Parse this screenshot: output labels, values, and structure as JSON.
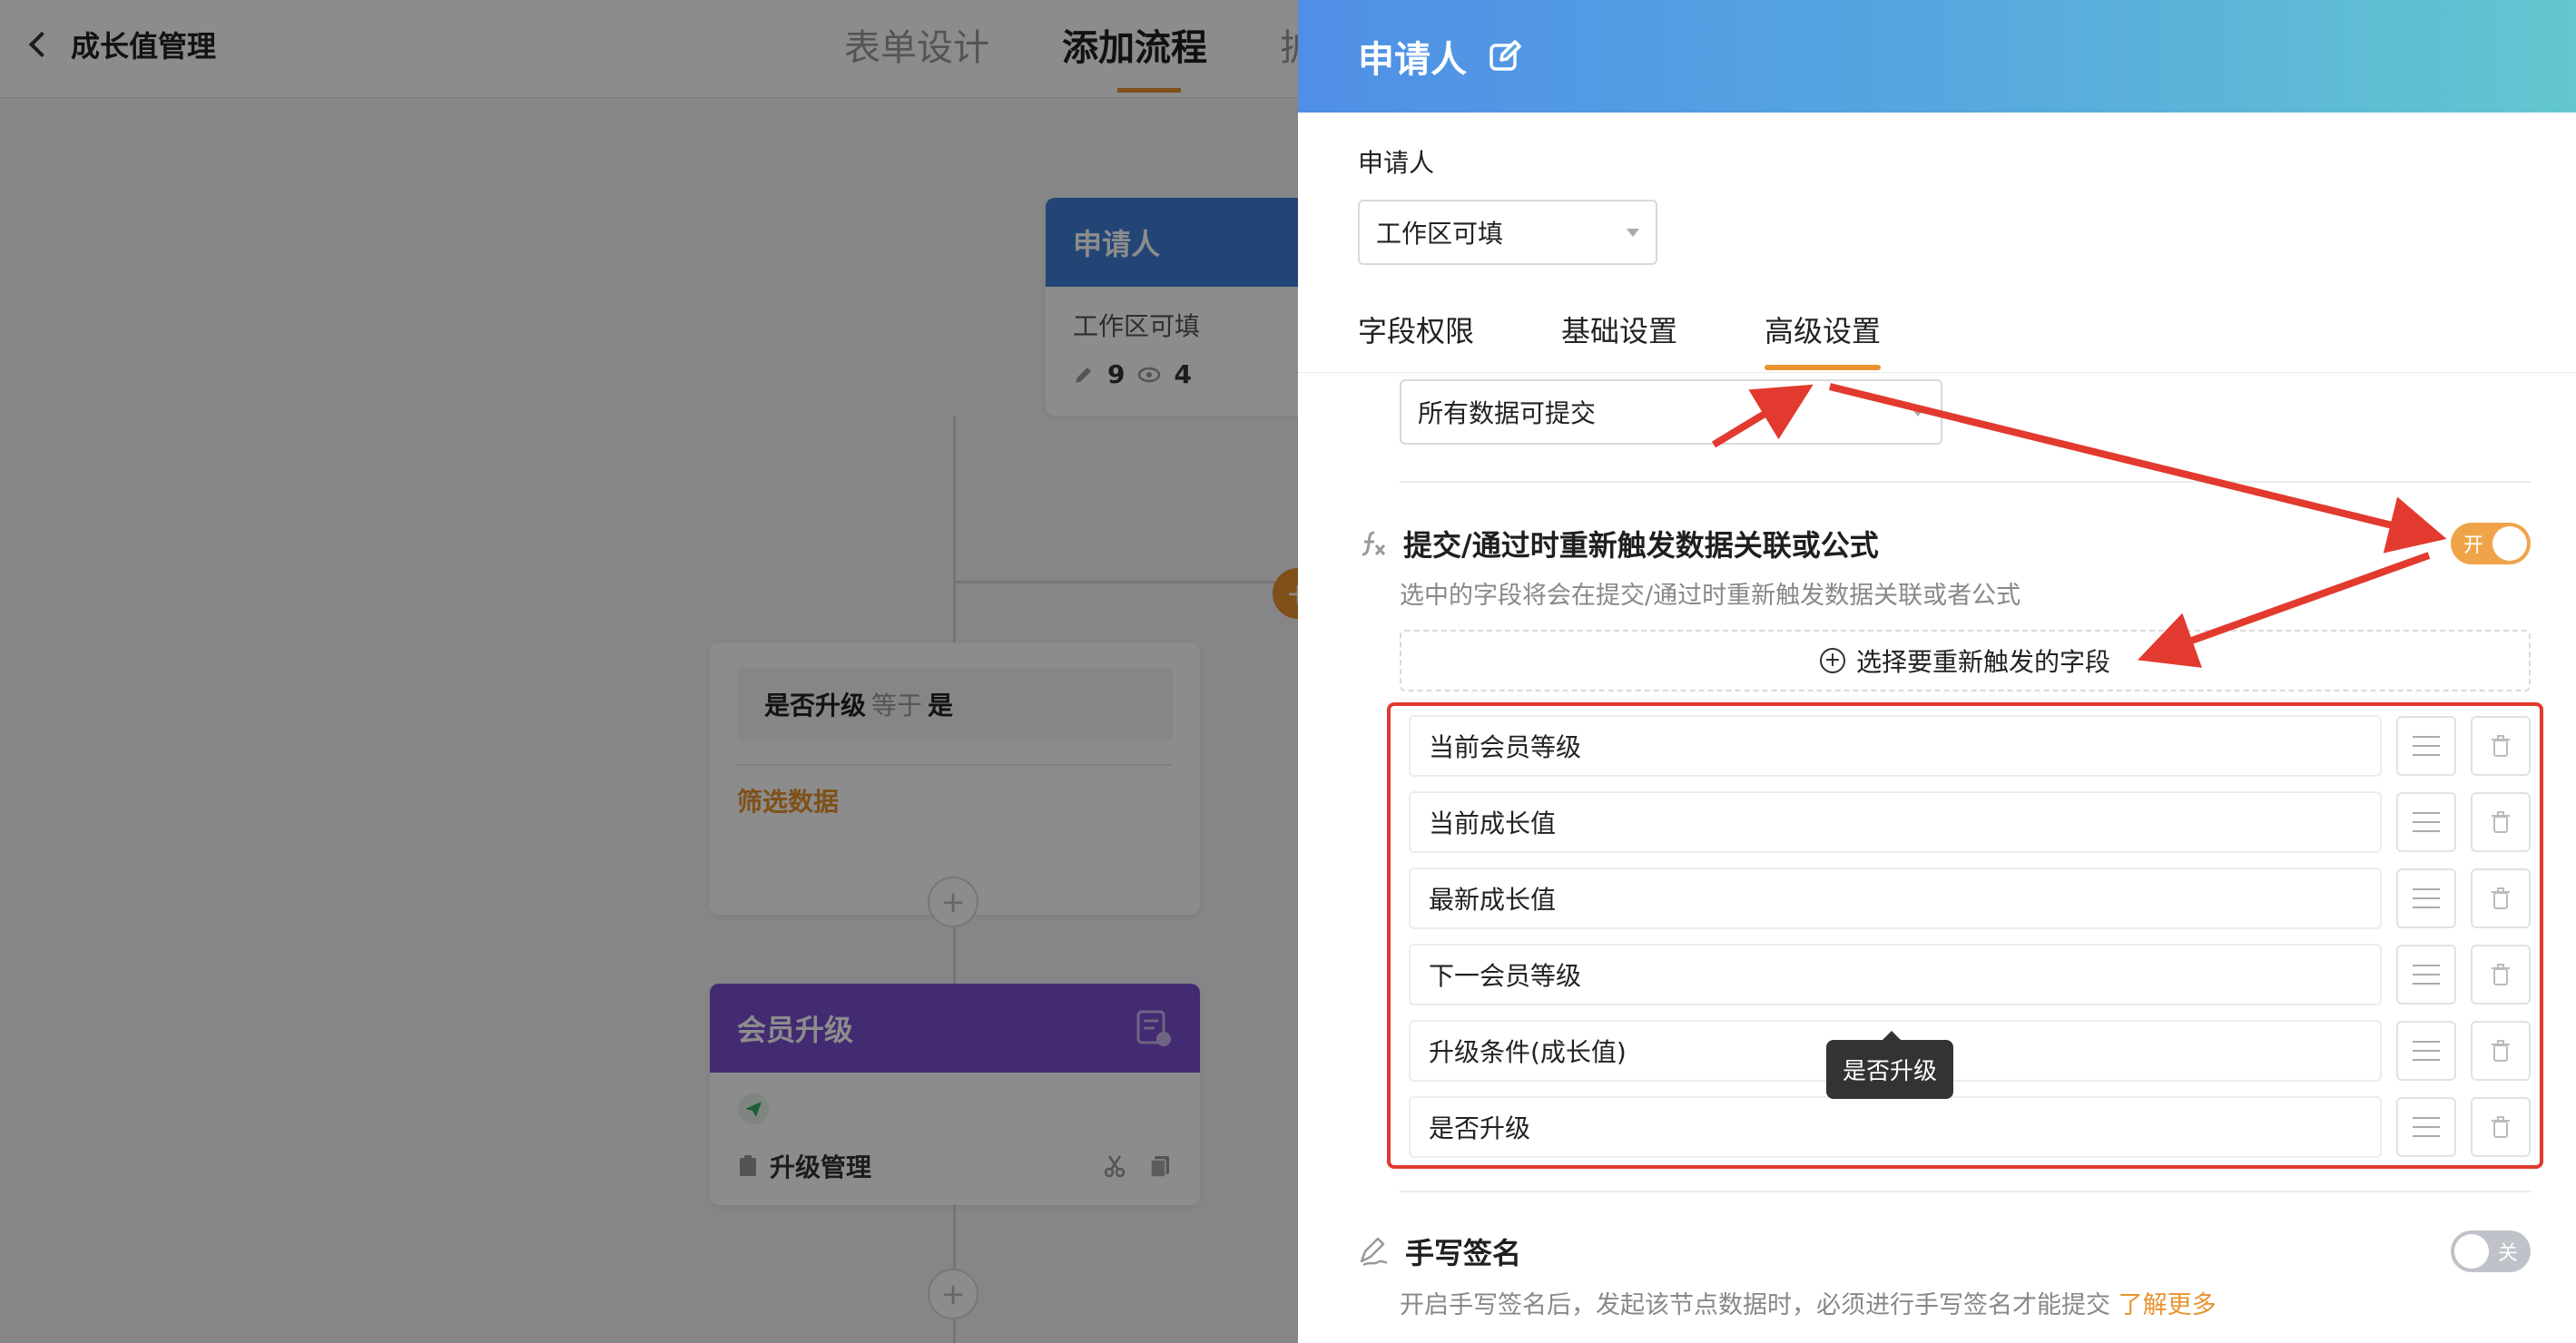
{
  "app": {
    "back_title": "成长值管理",
    "steps": [
      "表单设计",
      "添加流程",
      "扩"
    ],
    "nodes": {
      "applicant": {
        "title": "申请人",
        "subtitle": "工作区可填",
        "edit_count": "9",
        "view_count": "4"
      },
      "filter": {
        "cond_field": "是否升级",
        "cond_op": "等于",
        "cond_value": "是",
        "foot": "筛选数据"
      },
      "upgrade": {
        "title": "会员升级",
        "item": "升级管理"
      }
    },
    "plus": "+"
  },
  "drawer": {
    "title": "申请人",
    "applicant_label": "申请人",
    "applicant_select": "工作区可填",
    "tabs": [
      "字段权限",
      "基础设置",
      "高级设置"
    ],
    "submit_select": "所有数据可提交",
    "retrigger": {
      "title": "提交/通过时重新触发数据关联或公式",
      "desc": "选中的字段将会在提交/通过时重新触发数据关联或者公式",
      "toggle": "开",
      "add_label": "选择要重新触发的字段",
      "fields": [
        "当前会员等级",
        "当前成长值",
        "最新成长值",
        "下一会员等级",
        "升级条件(成长值)",
        "是否升级"
      ]
    },
    "tooltip": "是否升级",
    "signature": {
      "title": "手写签名",
      "desc": "开启手写签名后，发起该节点数据时，必须进行手写签名才能提交",
      "link": "了解更多",
      "toggle": "关"
    }
  },
  "colors": {
    "accent": "#e8932f",
    "annotation": "#e23a2e"
  }
}
